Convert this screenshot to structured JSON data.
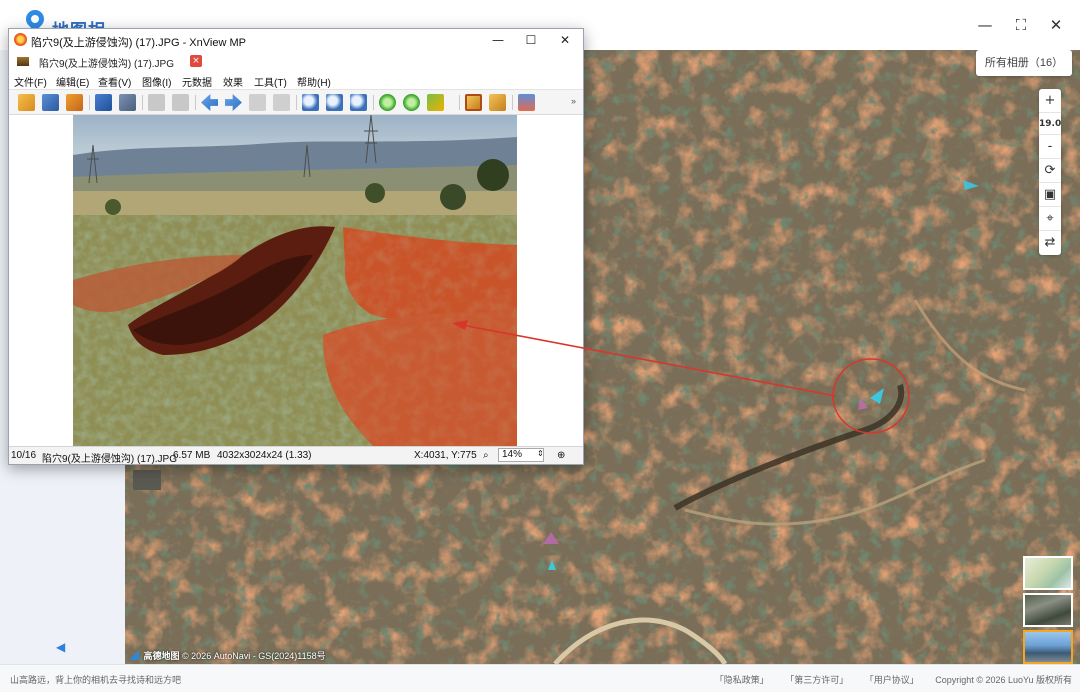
{
  "map_app": {
    "title": "地图相册",
    "window_controls": {
      "minimize": "—",
      "restore": "⛶",
      "close": "✕"
    },
    "album_chip": "所有相册（16）",
    "zoom_in": "+",
    "zoom_level": "19.0",
    "zoom_out": "-",
    "collapse_arrow": "◀",
    "attribution": {
      "brand": "高德地图",
      "text": "© 2026 AutoNavi - GS(2024)1158号"
    }
  },
  "footer": {
    "slogan": "山高路远，背上你的相机去寻找诗和远方吧",
    "links": [
      "「隐私政策」",
      "「第三方许可」",
      "「用户协议」"
    ],
    "copyright": "Copyright © 2026 LuoYu 版权所有"
  },
  "xnview": {
    "window_title": "陷穴9(及上游侵蚀沟) (17).JPG - XnView MP",
    "tab_label": "陷穴9(及上游侵蚀沟) (17).JPG",
    "tab_close": "×",
    "window_controls": {
      "minimize": "—",
      "maximize": "☐",
      "close": "✕"
    },
    "menu": [
      "文件(F)",
      "编辑(E)",
      "查看(V)",
      "图像(I)",
      "元数据",
      "效果",
      "工具(T)",
      "帮助(H)"
    ],
    "toolbar_more": "»",
    "status": {
      "index": "10/16",
      "filename": "陷穴9(及上游侵蚀沟) (17).JPG",
      "filesize": "6.57 MB",
      "dimensions": "4032x3024x24 (1.33)",
      "coords": "X:4031, Y:775",
      "zoom": "14%"
    }
  },
  "colors": {
    "accent": "#2f7fe0",
    "annotation": "#d9362b",
    "thumb_active_border": "#f5a623"
  }
}
